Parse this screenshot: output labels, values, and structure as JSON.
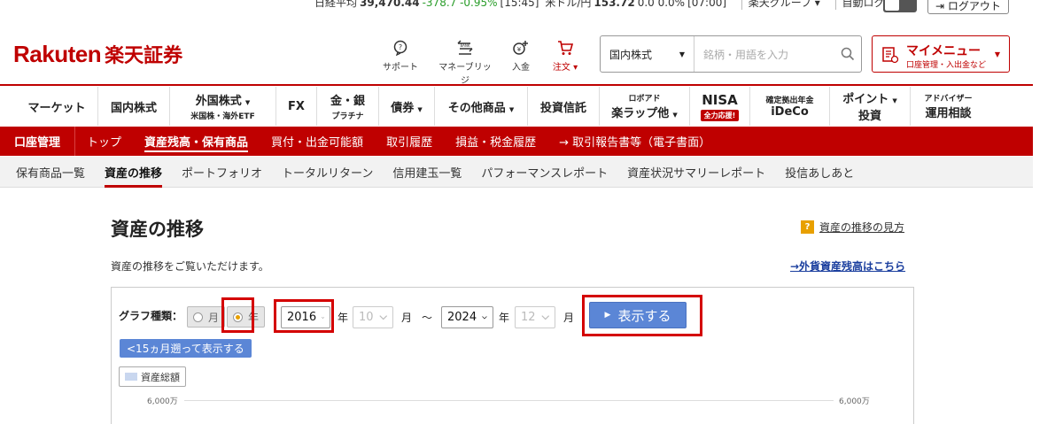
{
  "ticker": {
    "nikkei_label": "日経平均",
    "nikkei_value": "39,470.44",
    "nikkei_change": "-378.7 -0.95%",
    "nikkei_time": "[15:45]",
    "usdjpy_label": "米ドル/円",
    "usdjpy_value": "153.72",
    "usdjpy_change": "0.0 0.0%",
    "usdjpy_time": "[07:00]",
    "group_label": "楽天グループ ▾",
    "autologout_label": "自動ログアウト",
    "logout_label": "ログアウト"
  },
  "header": {
    "logo_en": "Rakuten",
    "logo_jp": "楽天証券",
    "icons": [
      {
        "label": "サポート",
        "icon": "support-icon"
      },
      {
        "label": "マネーブリッジ",
        "icon": "bank-icon"
      },
      {
        "label": "入金",
        "icon": "deposit-icon"
      },
      {
        "label": "注文 ▾",
        "icon": "cart-icon"
      }
    ],
    "search_category": "国内株式",
    "search_placeholder": "銘柄・用語を入力",
    "mymenu_title": "マイメニュー",
    "mymenu_sub": "口座管理・入出金など"
  },
  "gnav": [
    {
      "label": "マーケット",
      "sub": ""
    },
    {
      "label": "国内株式",
      "sub": ""
    },
    {
      "label": "外国株式",
      "sub": "米国株・海外ETF"
    },
    {
      "label": "FX",
      "sub": ""
    },
    {
      "label": "金・銀",
      "sub": "プラチナ"
    },
    {
      "label": "債券",
      "sub": ""
    },
    {
      "label": "その他商品",
      "sub": ""
    },
    {
      "label": "投資信託",
      "sub": ""
    },
    {
      "label": "ロボアド",
      "sub": "楽ラップ他"
    },
    {
      "label": "NISA",
      "sub": "全力応援!"
    },
    {
      "label": "確定拠出年金",
      "sub": "iDeCo"
    },
    {
      "label": "ポイント",
      "sub": "投資"
    },
    {
      "label": "アドバイザー",
      "sub": "運用相談"
    }
  ],
  "subnav": {
    "head": "口座管理",
    "links": [
      "トップ",
      "資産残高・保有商品",
      "買付・出金可能額",
      "取引履歴",
      "損益・税金履歴",
      "→ 取引報告書等（電子書面）"
    ]
  },
  "tnav": [
    "保有商品一覧",
    "資産の推移",
    "ポートフォリオ",
    "トータルリターン",
    "信用建玉一覧",
    "パフォーマンスレポート",
    "資産状況サマリーレポート",
    "投信あしあと"
  ],
  "main": {
    "title": "資産の推移",
    "howto": "資産の推移の見方",
    "intro": "資産の推移をご覧いただけます。",
    "fx_link": "→外貨資産残高はこちら",
    "graph_type_label": "グラフ種類：",
    "radio_month": "月",
    "radio_year": "年",
    "from_year": "2016",
    "from_month": "10",
    "to_year": "2024",
    "to_month": "12",
    "unit_year": "年",
    "unit_month": "月",
    "tilde": "～",
    "show_button": "表示する",
    "back_button": "<15ヵ月遡って表示する",
    "legend_label": "資産総額",
    "axis_left": "6,000万",
    "axis_right": "6,000万"
  }
}
